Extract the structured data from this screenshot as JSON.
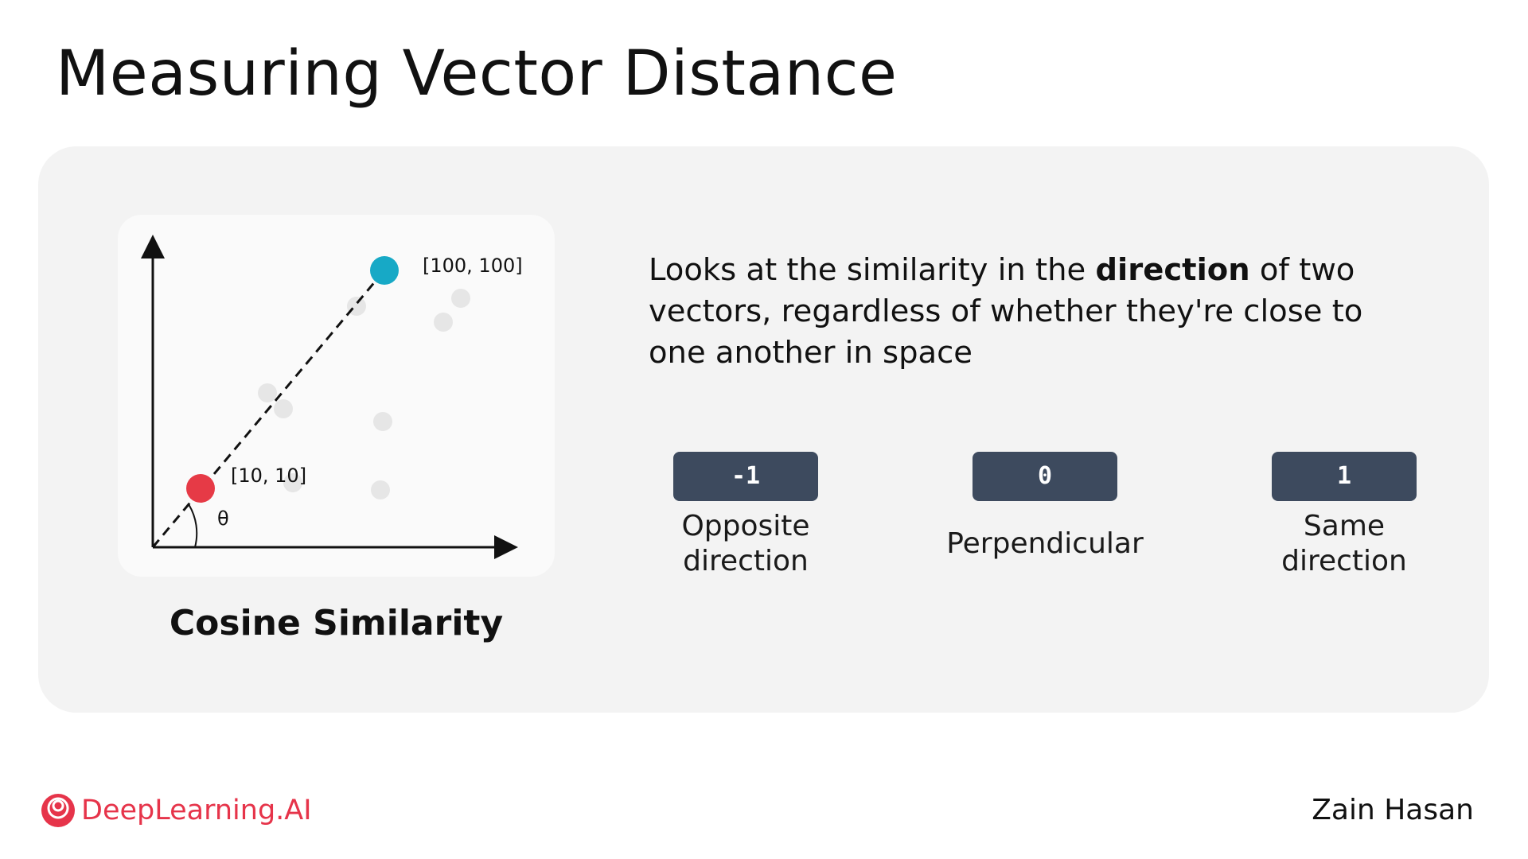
{
  "slide": {
    "title": "Measuring Vector Distance",
    "author": "Zain Hasan"
  },
  "diagram": {
    "caption": "Cosine Similarity",
    "angle_label": "θ",
    "point_a_label": "[10, 10]",
    "point_b_label": "[100, 100]",
    "colors": {
      "point_a": "#e63a46",
      "point_b": "#17a9c6",
      "background_points": "#e6e6e6",
      "axes": "#111111"
    }
  },
  "description": {
    "before": "Looks at the similarity in the",
    "bold": "direction",
    "after": "of two vectors, regardless of whether they're close to one another in space"
  },
  "scale": [
    {
      "value": "-1",
      "label": "Opposite\ndirection"
    },
    {
      "value": "0",
      "label": "Perpendicular"
    },
    {
      "value": "1",
      "label": "Same\ndirection"
    }
  ],
  "brand": {
    "name": "DeepLearning.AI",
    "color": "#e6344a",
    "icon": "deeplearning-logo-icon"
  }
}
